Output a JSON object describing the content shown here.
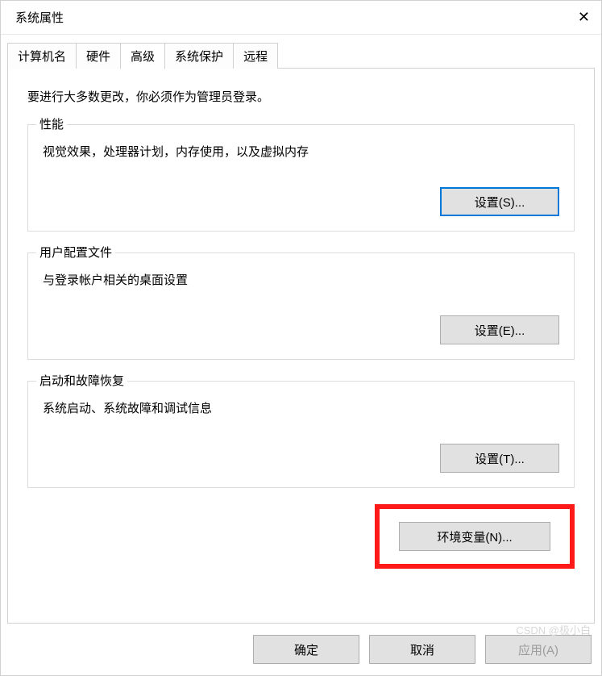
{
  "window": {
    "title": "系统属性"
  },
  "tabs": [
    {
      "label": "计算机名",
      "active": false
    },
    {
      "label": "硬件",
      "active": false
    },
    {
      "label": "高级",
      "active": true
    },
    {
      "label": "系统保护",
      "active": false
    },
    {
      "label": "远程",
      "active": false
    }
  ],
  "content": {
    "admin_note": "要进行大多数更改，你必须作为管理员登录。",
    "performance": {
      "title": "性能",
      "desc": "视觉效果，处理器计划，内存使用，以及虚拟内存",
      "button": "设置(S)..."
    },
    "user_profiles": {
      "title": "用户配置文件",
      "desc": "与登录帐户相关的桌面设置",
      "button": "设置(E)..."
    },
    "startup": {
      "title": "启动和故障恢复",
      "desc": "系统启动、系统故障和调试信息",
      "button": "设置(T)..."
    },
    "env_button": "环境变量(N)..."
  },
  "bottom": {
    "ok": "确定",
    "cancel": "取消",
    "apply": "应用(A)"
  },
  "watermark": "CSDN @极小白"
}
